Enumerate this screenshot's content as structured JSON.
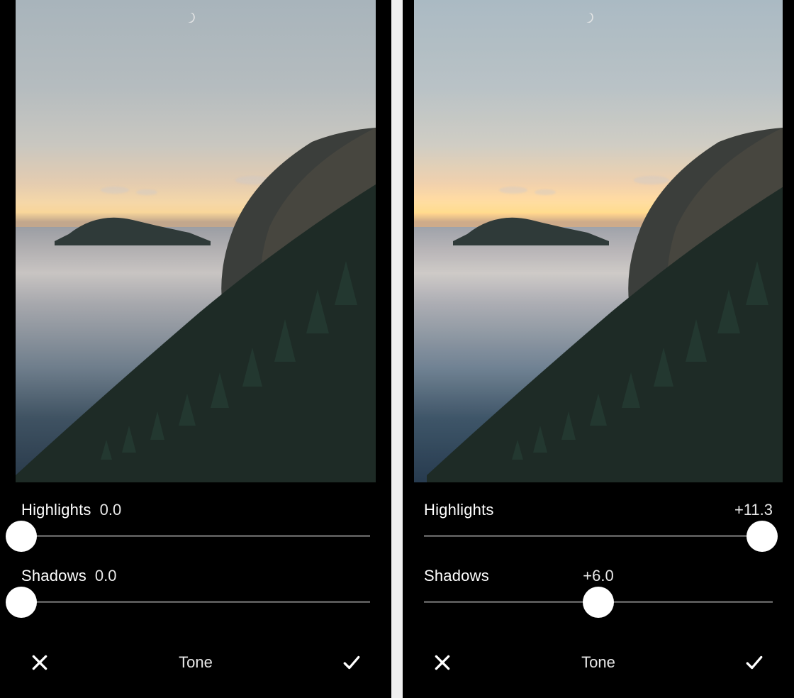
{
  "panels": [
    {
      "sliders": {
        "highlights": {
          "label": "Highlights",
          "value": "0.0",
          "thumb_pct": 0,
          "value_pos": "inline"
        },
        "shadows": {
          "label": "Shadows",
          "value": "0.0",
          "thumb_pct": 0,
          "value_pos": "inline"
        }
      },
      "footer": {
        "title": "Tone",
        "cancel_icon": "x-icon",
        "confirm_icon": "check-icon"
      }
    },
    {
      "sliders": {
        "highlights": {
          "label": "Highlights",
          "value": "+11.3",
          "thumb_pct": 97,
          "value_pos": "right"
        },
        "shadows": {
          "label": "Shadows",
          "value": "+6.0",
          "thumb_pct": 50,
          "value_pos": "center"
        }
      },
      "footer": {
        "title": "Tone",
        "cancel_icon": "x-icon",
        "confirm_icon": "check-icon"
      }
    }
  ]
}
